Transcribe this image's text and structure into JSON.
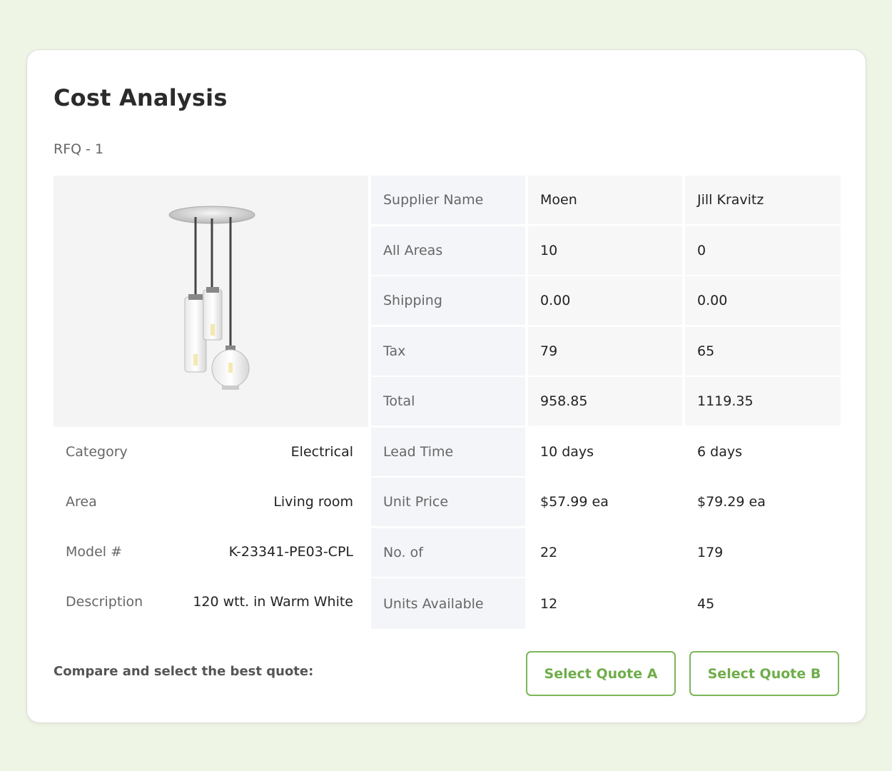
{
  "title": "Cost Analysis",
  "rfq": "RFQ - 1",
  "product": {
    "image_icon": "pendant-light-image",
    "attributes": [
      {
        "label": "Category",
        "value": "Electrical"
      },
      {
        "label": "Area",
        "value": "Living room"
      },
      {
        "label": "Model #",
        "value": "K-23341-PE03-CPL"
      },
      {
        "label": "Description",
        "value": "120 wtt. in Warm White"
      }
    ]
  },
  "comparison": {
    "rows": [
      {
        "label": "Supplier Name",
        "a": "Moen",
        "b": "Jill Kravitz"
      },
      {
        "label": "All Areas",
        "a": "10",
        "b": "0"
      },
      {
        "label": "Shipping",
        "a": "0.00",
        "b": "0.00"
      },
      {
        "label": "Tax",
        "a": "79",
        "b": "65"
      },
      {
        "label": "Total",
        "a": "958.85",
        "b": "1119.35"
      },
      {
        "label": "Lead Time",
        "a": "10 days",
        "b": "6 days"
      },
      {
        "label": "Unit Price",
        "a": "$57.99 ea",
        "b": "$79.29 ea"
      },
      {
        "label": "No. of",
        "a": "22",
        "b": "179"
      },
      {
        "label": "Units Available",
        "a": "12",
        "b": "45"
      }
    ]
  },
  "footer": {
    "prompt": "Compare and select the best quote:",
    "button_a": "Select Quote A",
    "button_b": "Select Quote B"
  },
  "colors": {
    "accent": "#7cb65a",
    "page_background": "#eef5e4",
    "label_column": "#f3f5f9"
  }
}
